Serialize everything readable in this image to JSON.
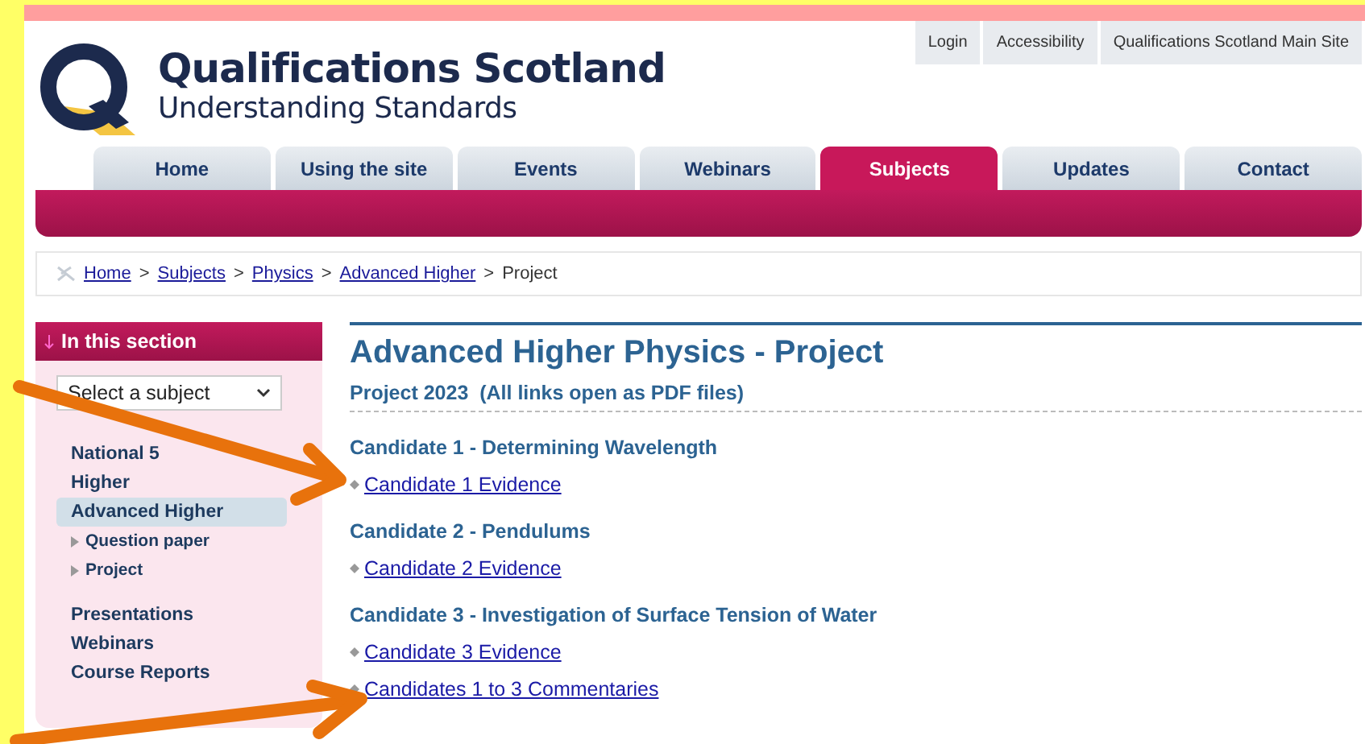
{
  "top_links": [
    "Login",
    "Accessibility",
    "Qualifications Scotland Main Site"
  ],
  "logo": {
    "title": "Qualifications Scotland",
    "subtitle": "Understanding Standards"
  },
  "tabs": [
    {
      "label": "Home",
      "selected": false
    },
    {
      "label": "Using the site",
      "selected": false
    },
    {
      "label": "Events",
      "selected": false
    },
    {
      "label": "Webinars",
      "selected": false
    },
    {
      "label": "Subjects",
      "selected": true
    },
    {
      "label": "Updates",
      "selected": false
    },
    {
      "label": "Contact",
      "selected": false
    }
  ],
  "breadcrumb": {
    "links": [
      "Home",
      "Subjects",
      "Physics",
      "Advanced Higher"
    ],
    "separator": ">",
    "current": "Project"
  },
  "sidebar": {
    "title": "In this section",
    "select": {
      "value": "Select a subject"
    },
    "items": [
      {
        "label": "National 5",
        "selected": false
      },
      {
        "label": "Higher",
        "selected": false
      },
      {
        "label": "Advanced Higher",
        "selected": true,
        "children": [
          {
            "label": "Question paper"
          },
          {
            "label": "Project"
          }
        ]
      },
      {
        "label": "Presentations",
        "selected": false
      },
      {
        "label": "Webinars",
        "selected": false
      },
      {
        "label": "Course Reports",
        "selected": false
      }
    ]
  },
  "content": {
    "title": "Advanced Higher Physics - Project",
    "subtitle": "Project 2023  (All links open as PDF files)",
    "sections": [
      {
        "heading": "Candidate 1 - Determining Wavelength",
        "links": [
          "Candidate 1 Evidence"
        ]
      },
      {
        "heading": "Candidate 2 - Pendulums",
        "links": [
          "Candidate 2 Evidence"
        ]
      },
      {
        "heading": "Candidate 3 - Investigation of Surface Tension of Water",
        "links": [
          "Candidate 3 Evidence",
          "Candidates 1 to 3 Commentaries"
        ]
      }
    ]
  }
}
